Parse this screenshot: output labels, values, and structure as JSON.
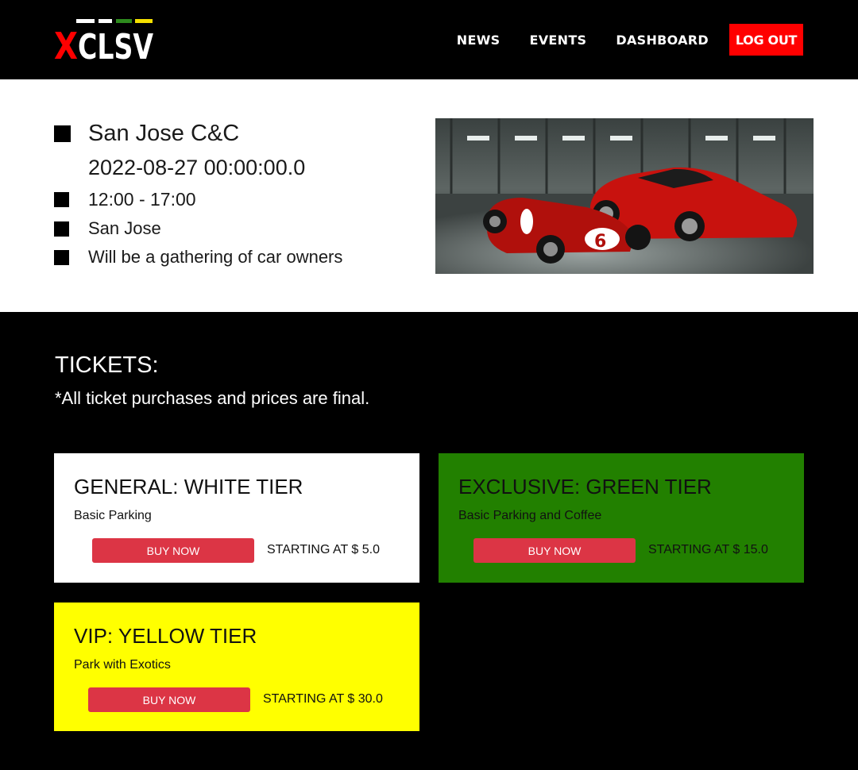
{
  "header": {
    "logo_text": "XCLSV",
    "nav": {
      "news": "NEWS",
      "events": "EVENTS",
      "dashboard": "DASHBOARD",
      "logout": "LOG OUT"
    },
    "colors": {
      "logout_bg": "#ff0000",
      "logo_red": "#ff0000",
      "logo_green": "#2e8b1e",
      "logo_yellow": "#f5e000"
    }
  },
  "event": {
    "title": "San Jose C&C",
    "date": "2022-08-27 00:00:00.0",
    "time": "12:00 - 17:00",
    "location": "San Jose",
    "description": "Will be a gathering of car owners",
    "image_icon": "car-photo"
  },
  "tickets": {
    "heading": "TICKETS:",
    "note": "*All ticket purchases and prices are final.",
    "tiers": [
      {
        "name": "GENERAL: WHITE TIER",
        "desc": "Basic Parking",
        "button": "BUY NOW",
        "price": "STARTING AT $ 5.0",
        "color": "#ffffff"
      },
      {
        "name": "EXCLUSIVE: GREEN TIER",
        "desc": "Basic Parking and Coffee",
        "button": "BUY NOW",
        "price": "STARTING AT $ 15.0",
        "color": "#228000"
      },
      {
        "name": "VIP: YELLOW TIER",
        "desc": "Park with Exotics",
        "button": "BUY NOW",
        "price": "STARTING AT $ 30.0",
        "color": "#ffff00"
      }
    ]
  }
}
